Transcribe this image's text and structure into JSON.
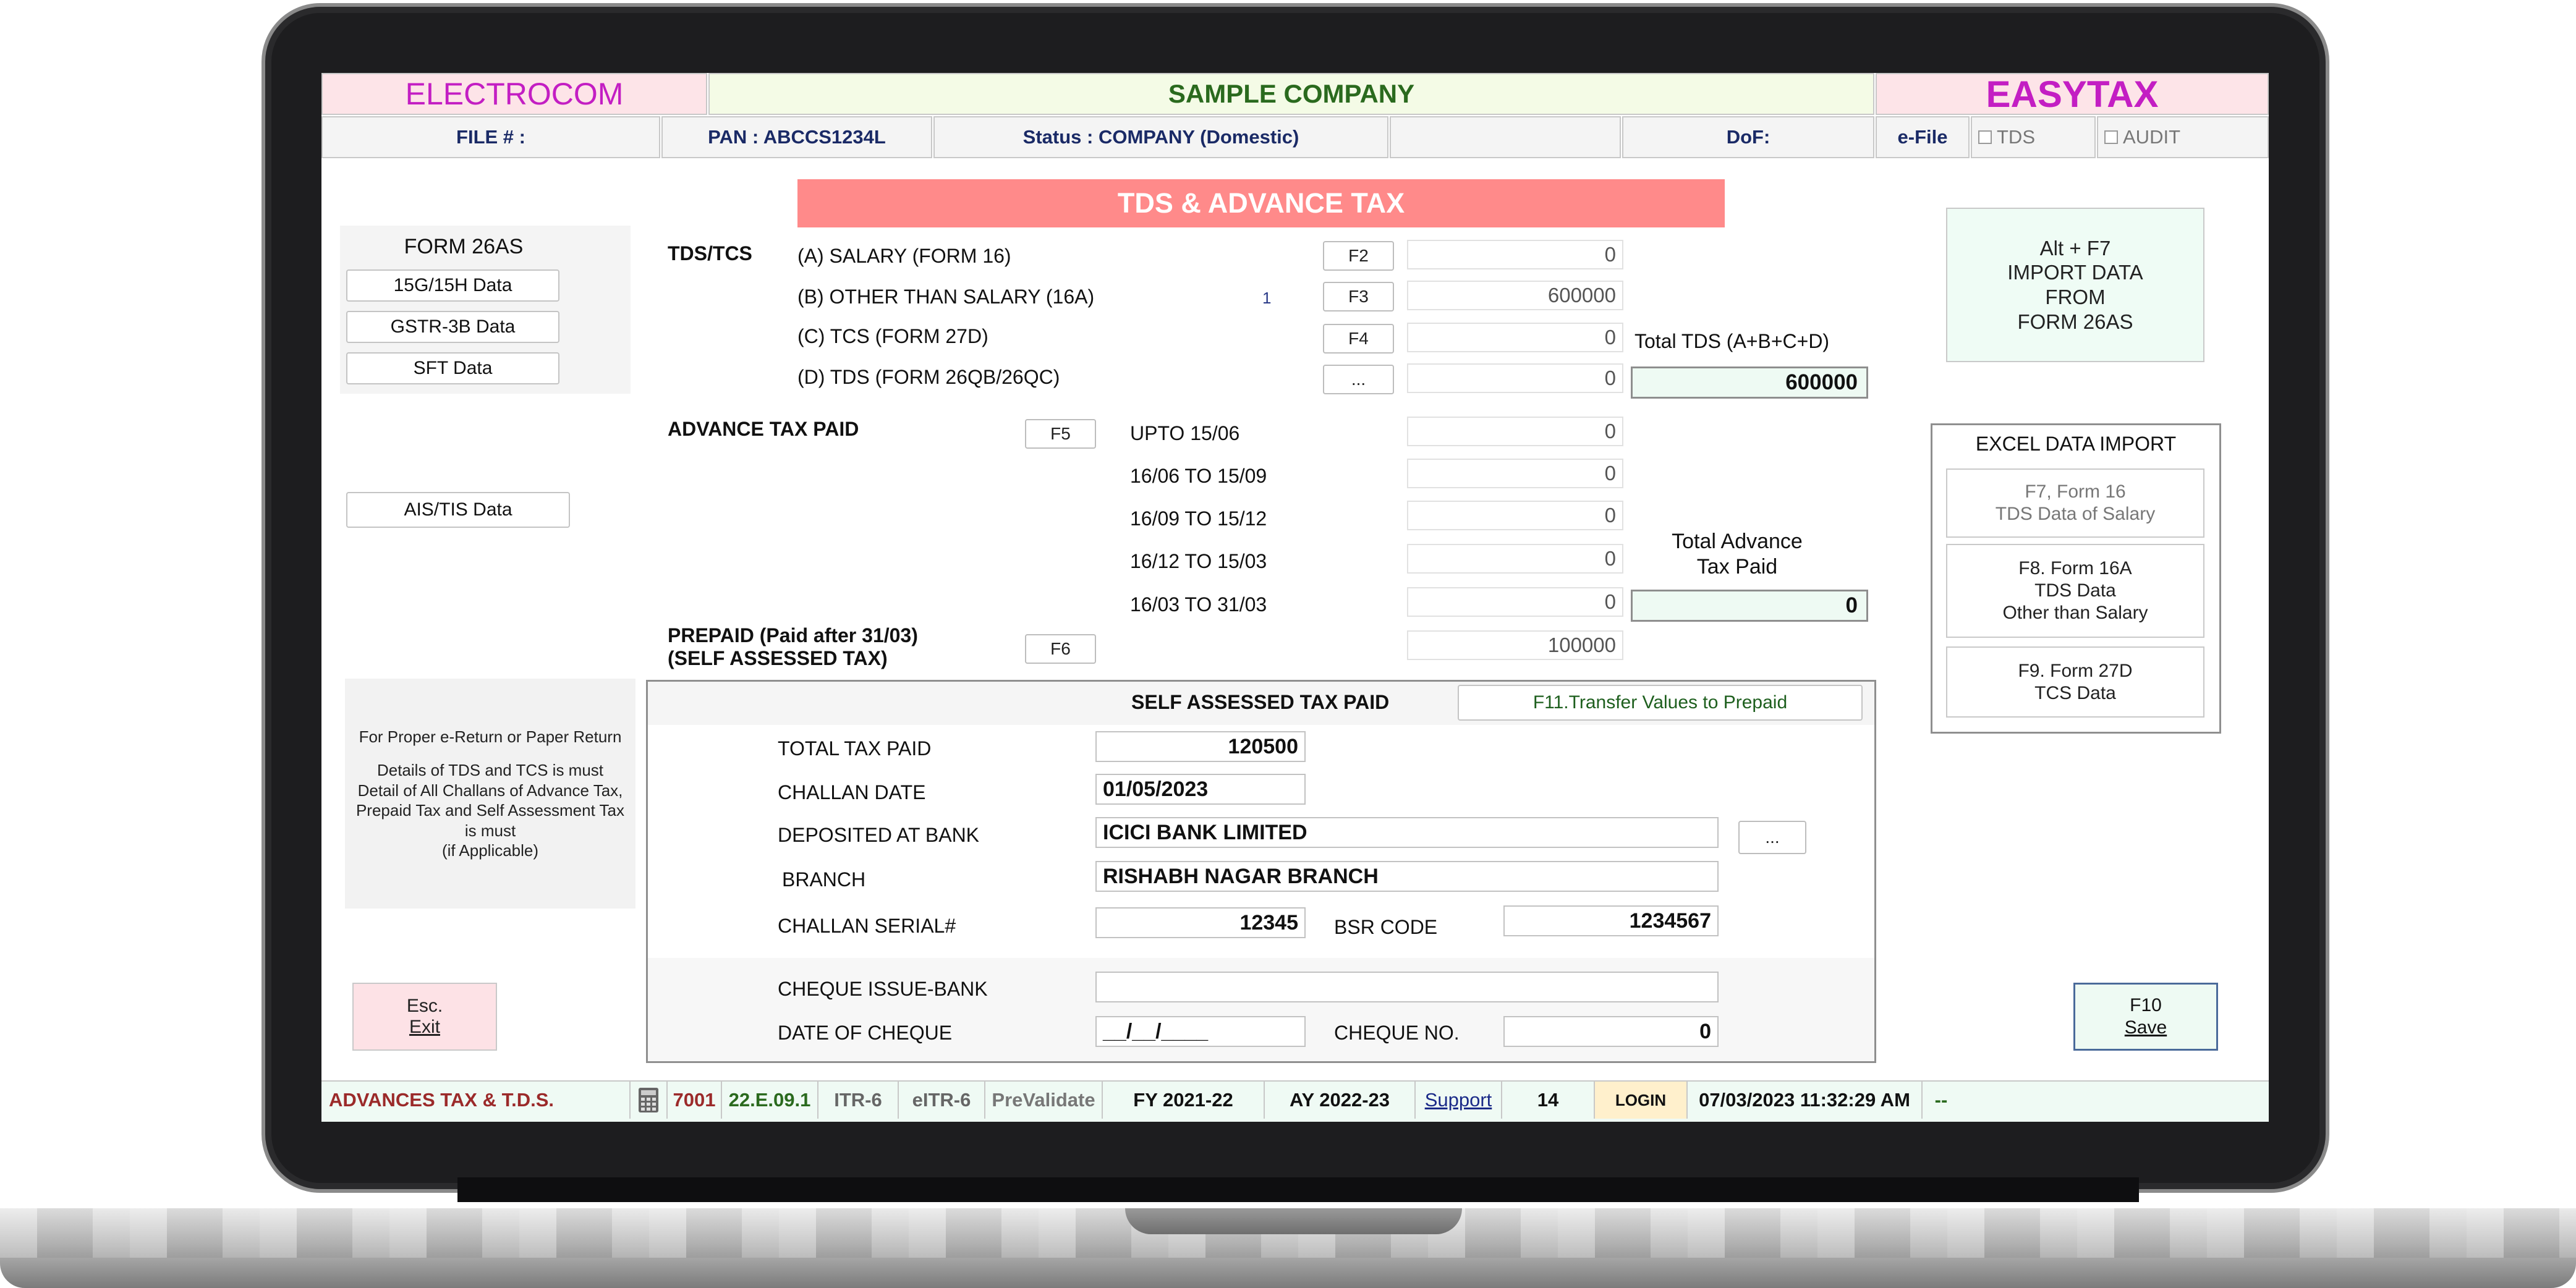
{
  "header": {
    "left_brand": "ELECTROCOM",
    "company": "SAMPLE COMPANY",
    "right_brand": "EASYTAX"
  },
  "info_bar": {
    "file": "FILE # :",
    "pan": "PAN : ABCCS1234L",
    "status": "Status : COMPANY (Domestic)",
    "dof": "DoF:",
    "efile": "e-File",
    "tds": "TDS",
    "audit": "AUDIT"
  },
  "left_panel": {
    "form26as": "FORM 26AS",
    "btn_15g": "15G/15H Data",
    "btn_gstr": "GSTR-3B Data",
    "btn_sft": "SFT Data",
    "btn_ais": "AIS/TIS Data",
    "note_line1": "For Proper e-Return or Paper Return",
    "note_line2": "Details of TDS and TCS is must",
    "note_line3": "Detail of All Challans of Advance Tax,",
    "note_line4": "Prepaid Tax and Self Assessment Tax",
    "note_line5": "is must",
    "note_line6": "(if Applicable)",
    "esc_line1": "Esc.",
    "esc_line2": "Exit"
  },
  "title": "TDS & ADVANCE TAX",
  "tds": {
    "section_label": "TDS/TCS",
    "rows": [
      {
        "label": "(A)  SALARY (FORM 16)",
        "key": "F2",
        "value": "0",
        "count": ""
      },
      {
        "label": "(B)  OTHER THAN SALARY (16A)",
        "key": "F3",
        "value": "600000",
        "count": "1"
      },
      {
        "label": "(C)  TCS (FORM 27D)",
        "key": "F4",
        "value": "0",
        "count": ""
      },
      {
        "label": "(D) TDS (FORM 26QB/26QC)",
        "key": "...",
        "value": "0",
        "count": ""
      }
    ],
    "total_label": "Total TDS (A+B+C+D)",
    "total_value": "600000"
  },
  "advance": {
    "section_label": "ADVANCE TAX PAID",
    "key": "F5",
    "rows": [
      {
        "label": "UPTO 15/06",
        "value": "0"
      },
      {
        "label": "16/06 TO 15/09",
        "value": "0"
      },
      {
        "label": "16/09 TO 15/12",
        "value": "0"
      },
      {
        "label": "16/12 TO 15/03",
        "value": "0"
      },
      {
        "label": "16/03 TO 31/03",
        "value": "0"
      }
    ],
    "total_label_1": "Total Advance",
    "total_label_2": "Tax Paid",
    "total_value": "0"
  },
  "prepaid": {
    "label_1": "PREPAID (Paid after 31/03)",
    "label_2": "(SELF ASSESSED TAX)",
    "key": "F6",
    "value": "100000"
  },
  "self_assessed": {
    "heading": "SELF ASSESSED TAX PAID",
    "transfer_button": "F11.Transfer Values to Prepaid",
    "total_label": "TOTAL TAX PAID",
    "total_value": "120500",
    "date_label": "CHALLAN DATE",
    "date_value": "01/05/2023",
    "bank_label": "DEPOSITED AT BANK",
    "bank_value": "ICICI BANK LIMITED",
    "bank_button": "...",
    "branch_label": "BRANCH",
    "branch_value": "RISHABH NAGAR BRANCH",
    "serial_label": "CHALLAN SERIAL#",
    "serial_value": "12345",
    "bsr_label": "BSR CODE",
    "bsr_value": "1234567",
    "cheque_bank_label": "CHEQUE ISSUE-BANK",
    "cheque_bank_value": "",
    "cheque_date_label": "DATE OF CHEQUE",
    "cheque_date_value": "__/__/____",
    "cheque_no_label": "CHEQUE NO.",
    "cheque_no_value": "0"
  },
  "right_panel": {
    "import_line1": "Alt + F7",
    "import_line2": "IMPORT DATA",
    "import_line3": "FROM",
    "import_line4": "FORM 26AS",
    "excel_heading": "EXCEL DATA IMPORT",
    "f7_line1": "F7, Form 16",
    "f7_line2": "TDS Data of Salary",
    "f8_line1": "F8. Form 16A",
    "f8_line2": "TDS Data",
    "f8_line3": "Other than Salary",
    "f9_line1": "F9. Form 27D",
    "f9_line2": "TCS Data",
    "save_line1": "F10",
    "save_line2": "Save"
  },
  "status_bar": {
    "module": "ADVANCES TAX & T.D.S.",
    "code": "7001",
    "version": "22.E.09.1",
    "itr": "ITR-6",
    "eitr": "eITR-6",
    "prevalidate": "PreValidate",
    "fy": "FY 2021-22",
    "ay": "AY 2022-23",
    "support": "Support",
    "number": "14",
    "login": "LOGIN",
    "datetime": "07/03/2023 11:32:29 AM",
    "end": "--"
  },
  "colors": {
    "title_bg": "#ff8a8a",
    "brand_magenta": "#c31ec3",
    "company_green": "#2a6a1e",
    "status_red": "#9b2a2a"
  }
}
